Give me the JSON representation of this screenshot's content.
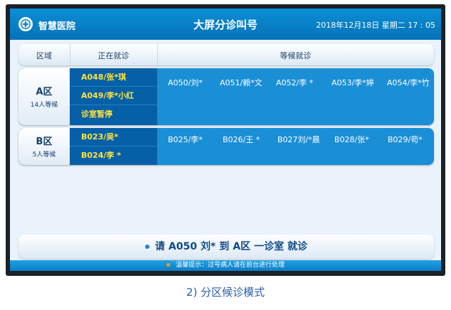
{
  "header": {
    "hospital_name": "智慧医院",
    "title": "大屏分诊叫号",
    "datetime": "2018年12月18日  星期二  17 : 05"
  },
  "columns": {
    "area": "区域",
    "current": "正在就诊",
    "waiting": "等候就诊"
  },
  "areas": [
    {
      "name": "A区",
      "waiting_count": "14人等候",
      "current": [
        "A048/张*琪",
        "A049/李*小红",
        "诊室暂停"
      ],
      "waiting": [
        "A050/刘*",
        "A051/赖*文",
        "A052/李  *",
        "A053/李*婷",
        "A054/李*竹"
      ]
    },
    {
      "name": "B区",
      "waiting_count": "5人等候",
      "current": [
        "B023/吴*",
        "B024/李  *"
      ],
      "waiting": [
        "B025/李*",
        "B026/王  *",
        "B027刘/*晨",
        "B028/张*",
        "B029/苟*"
      ]
    }
  ],
  "notice": {
    "prefix": "请",
    "ticket": "A050",
    "patient": "刘*",
    "to": "到",
    "area": "A区",
    "room": "一诊室",
    "action": "就诊"
  },
  "tip": "温馨提示：过号病人请在前台进行处理",
  "caption": "2) 分区候诊模式",
  "colors": {
    "header_blue": "#0a84cc",
    "row_blue": "#1a8fd6",
    "current_col_blue": "#0660a8",
    "current_text_yellow": "#ffe33a",
    "tip_dot_orange": "#ff9a1a"
  }
}
